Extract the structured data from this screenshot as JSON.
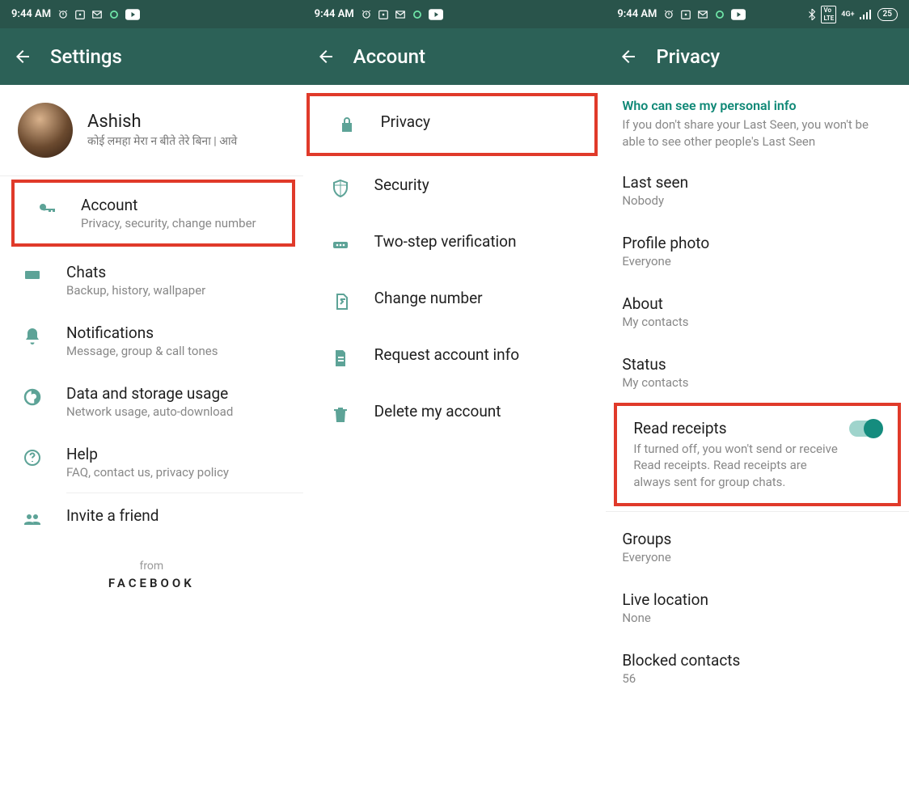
{
  "statusbar": {
    "time": "9:44 AM",
    "battery": "25"
  },
  "screen1": {
    "title": "Settings",
    "profile": {
      "name": "Ashish",
      "status": "कोई लमहा मेरा न बीते तेरे बिना | आवे"
    },
    "items": [
      {
        "icon": "key",
        "title": "Account",
        "sub": "Privacy, security, change number"
      },
      {
        "icon": "chat",
        "title": "Chats",
        "sub": "Backup, history, wallpaper"
      },
      {
        "icon": "bell",
        "title": "Notifications",
        "sub": "Message, group & call tones"
      },
      {
        "icon": "data",
        "title": "Data and storage usage",
        "sub": "Network usage, auto-download"
      },
      {
        "icon": "help",
        "title": "Help",
        "sub": "FAQ, contact us, privacy policy"
      },
      {
        "icon": "people",
        "title": "Invite a friend",
        "sub": ""
      }
    ],
    "footer_from": "from",
    "footer_brand": "FACEBOOK"
  },
  "screen2": {
    "title": "Account",
    "items": [
      {
        "icon": "lock",
        "title": "Privacy"
      },
      {
        "icon": "shield",
        "title": "Security"
      },
      {
        "icon": "dots",
        "title": "Two-step verification"
      },
      {
        "icon": "sim",
        "title": "Change number"
      },
      {
        "icon": "doc",
        "title": "Request account info"
      },
      {
        "icon": "trash",
        "title": "Delete my account"
      }
    ]
  },
  "screen3": {
    "title": "Privacy",
    "header": "Who can see my personal info",
    "header_desc": "If you don't share your Last Seen, you won't be able to see other people's Last Seen",
    "items": [
      {
        "title": "Last seen",
        "value": "Nobody"
      },
      {
        "title": "Profile photo",
        "value": "Everyone"
      },
      {
        "title": "About",
        "value": "My contacts"
      },
      {
        "title": "Status",
        "value": "My contacts"
      }
    ],
    "read_receipts": {
      "title": "Read receipts",
      "desc": "If turned off, you won't send or receive Read receipts. Read receipts are always sent for group chats.",
      "on": true
    },
    "after": [
      {
        "title": "Groups",
        "value": "Everyone"
      },
      {
        "title": "Live location",
        "value": "None"
      },
      {
        "title": "Blocked contacts",
        "value": "56"
      }
    ]
  }
}
